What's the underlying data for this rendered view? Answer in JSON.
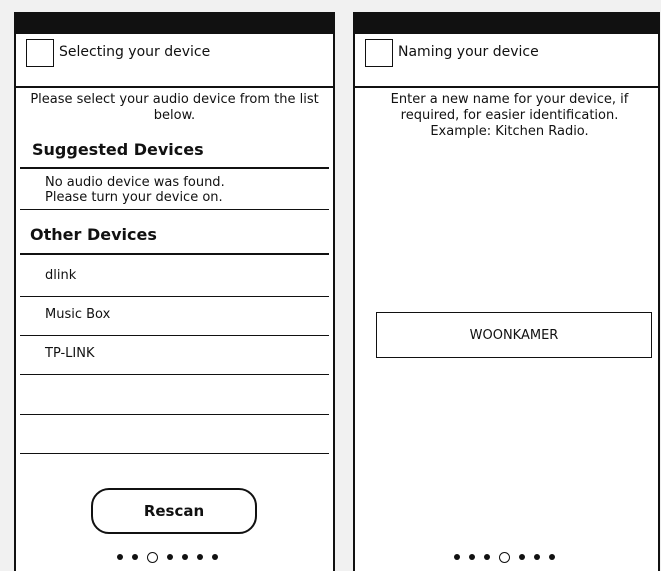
{
  "left_screen": {
    "title": "Selecting your device",
    "instructions": "Please select your audio device from the list below.",
    "suggested_header": "Suggested Devices",
    "no_device_message": "No audio device was found.\nPlease turn your device on.",
    "other_header": "Other Devices",
    "devices": [
      "dlink",
      "Music Box",
      "TP-LINK",
      "",
      ""
    ],
    "rescan_label": "Rescan",
    "page_indicator": {
      "total": 7,
      "current": 3
    }
  },
  "right_screen": {
    "title": "Naming your device",
    "instructions": "Enter a new name for your device, if required, for easier identification.\nExample: Kitchen Radio.",
    "device_name_value": "WOONKAMER",
    "page_indicator": {
      "total": 7,
      "current": 4
    }
  }
}
